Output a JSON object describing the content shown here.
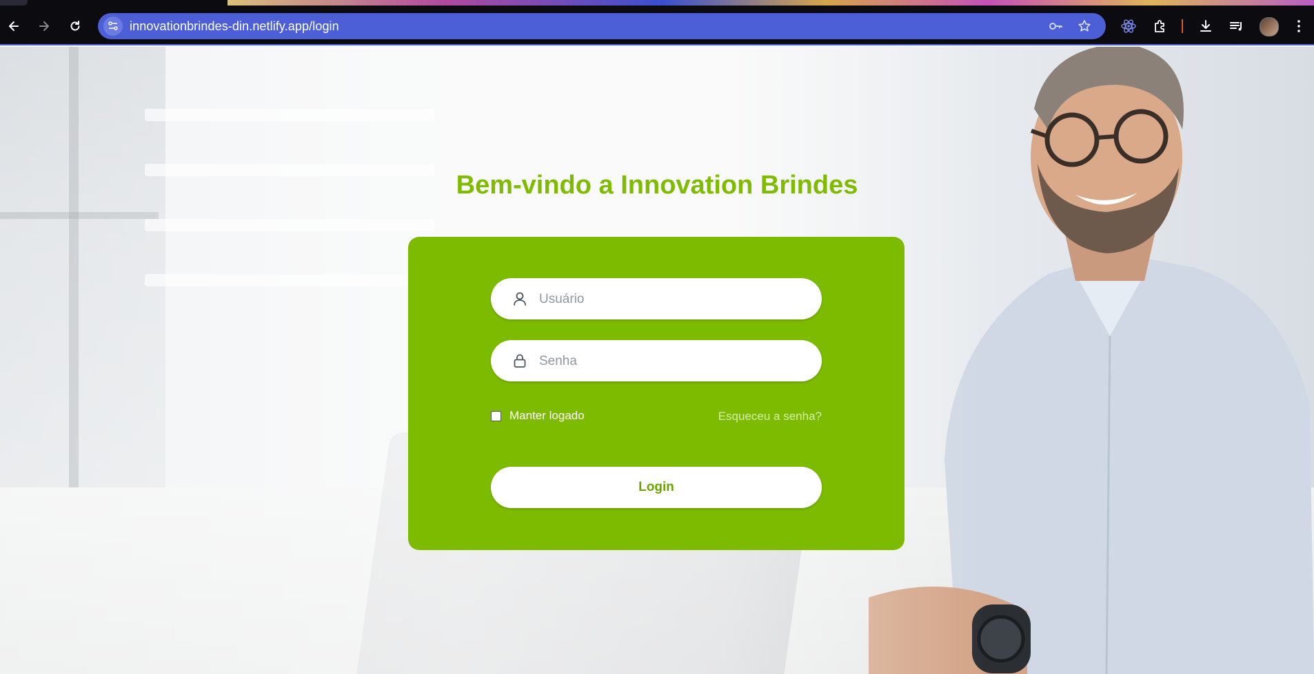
{
  "browser": {
    "url": "innovationbrindes-din.netlify.app/login",
    "accent_color": "#4d5fd6",
    "icons": [
      "back-icon",
      "forward-icon",
      "reload-icon",
      "site-info-icon",
      "password-key-icon",
      "bookmark-star-icon",
      "react-devtools-icon",
      "extensions-icon",
      "download-icon",
      "media-control-icon",
      "profile-avatar",
      "menu-icon"
    ]
  },
  "page": {
    "title": "Bem-vindo a Innovation Brindes",
    "brand_color": "#7fbb00"
  },
  "form": {
    "username_placeholder": "Usuário",
    "password_placeholder": "Senha",
    "remember_label": "Manter logado",
    "forgot_label": "Esqueceu a senha?",
    "login_label": "Login"
  }
}
